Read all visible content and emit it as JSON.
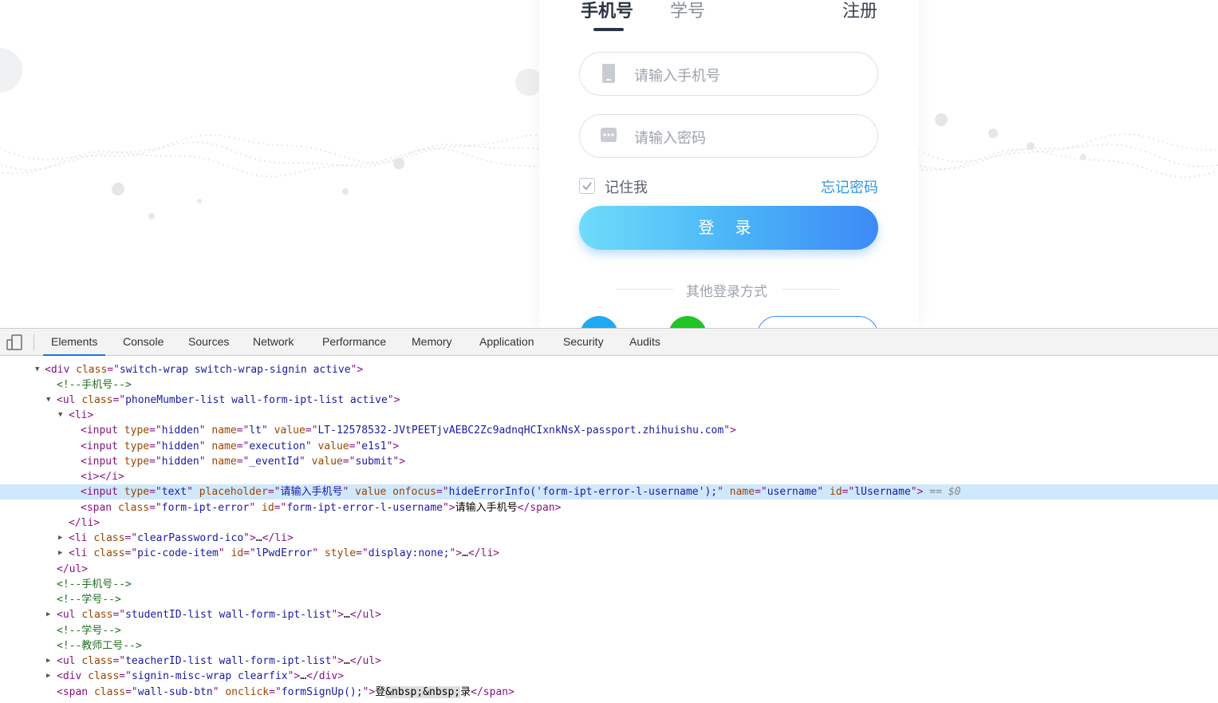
{
  "login": {
    "tabs": {
      "phone": "手机号",
      "student": "学号",
      "register": "注册"
    },
    "phone_placeholder": "请输入手机号",
    "password_placeholder": "请输入密码",
    "remember": "记住我",
    "forgot": "忘记密码",
    "submit": "登 录",
    "other_methods": "其他登录方式"
  },
  "devtools": {
    "tabs": [
      "Elements",
      "Console",
      "Sources",
      "Network",
      "Performance",
      "Memory",
      "Application",
      "Security",
      "Audits"
    ],
    "active_tab": "Elements",
    "lines": {
      "l0_text": "<div class=\"switch-wrap switch-wrap-signin active\">",
      "l0_tag": "div",
      "l0_cls": "switch-wrap switch-wrap-signin active",
      "l1": "<!--手机号-->",
      "l2_tag": "ul",
      "l2_cls": "phoneMumber-list wall-form-ipt-list active",
      "l3_tag": "li",
      "l4_name": "lt",
      "l4_value": "LT-12578532-JVtPEETjvAEBC2Zc9adnqHCIxnkNsX-passport.zhihuishu.com",
      "l5_name": "execution",
      "l5_value": "e1s1",
      "l6_name": "_eventId",
      "l6_value": "submit",
      "l7": "<i></i>",
      "l8_type": "text",
      "l8_placeholder": "请输入手机号",
      "l8_onfocus": "hideErrorInfo('form-ipt-error-l-username');",
      "l8_name": "username",
      "l8_id": "lUsername",
      "l8_suffix": "== $0",
      "l9_cls": "form-ipt-error",
      "l9_id": "form-ipt-error-l-username",
      "l9_text": "请输入手机号",
      "l10": "</li>",
      "l11_cls": "clearPassword-ico",
      "l12_cls": "pic-code-item",
      "l12_id": "lPwdError",
      "l12_style": "display:none;",
      "l13": "</ul>",
      "l14": "<!--手机号-->",
      "l15": "<!--学号-->",
      "l16_cls": "studentID-list wall-form-ipt-list",
      "l17": "<!--学号-->",
      "l18": "<!--教师工号-->",
      "l19_cls": "teacherID-list wall-form-ipt-list",
      "l20_cls": "signin-misc-wrap clearfix",
      "l21_cls": "wall-sub-btn",
      "l21_onclick": "formSignUp();",
      "l21_t1": "登",
      "l21_ent": "&nbsp;&nbsp;",
      "l21_t2": "录"
    }
  }
}
